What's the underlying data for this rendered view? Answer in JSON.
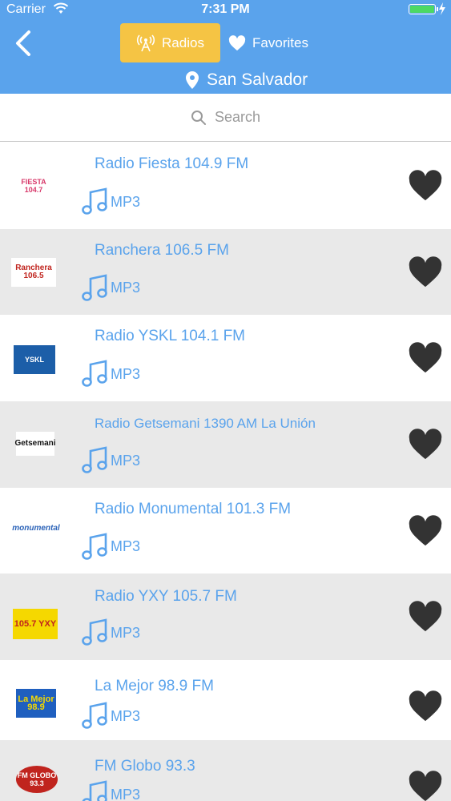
{
  "status_bar": {
    "carrier": "Carrier",
    "time": "7:31 PM"
  },
  "header": {
    "radios_tab": "Radios",
    "favorites_tab": "Favorites",
    "location": "San Salvador"
  },
  "search": {
    "placeholder": "Search"
  },
  "colors": {
    "header": "#5aa3ec",
    "active_tab": "#f5c444",
    "accent_text": "#5aa3ec",
    "heart": "#333333",
    "alt_row": "#e9e9e9"
  },
  "stations": [
    {
      "name": "Radio Fiesta 104.9 FM",
      "format": "MP3",
      "logo_text": "FIESTA 104.7"
    },
    {
      "name": "Ranchera 106.5 FM",
      "format": "MP3",
      "logo_text": "Ranchera 106.5"
    },
    {
      "name": "Radio YSKL 104.1 FM",
      "format": "MP3",
      "logo_text": "YSKL"
    },
    {
      "name": "Radio Getsemani 1390 AM La Unión",
      "format": "MP3",
      "logo_text": "Getsemani"
    },
    {
      "name": "Radio Monumental 101.3 FM",
      "format": "MP3",
      "logo_text": "monumental"
    },
    {
      "name": "Radio YXY 105.7 FM",
      "format": "MP3",
      "logo_text": "105.7 YXY"
    },
    {
      "name": "La Mejor 98.9 FM",
      "format": "MP3",
      "logo_text": "La Mejor 98.9"
    },
    {
      "name": "FM Globo 93.3",
      "format": "MP3",
      "logo_text": "FM GLOBO 93.3"
    }
  ]
}
